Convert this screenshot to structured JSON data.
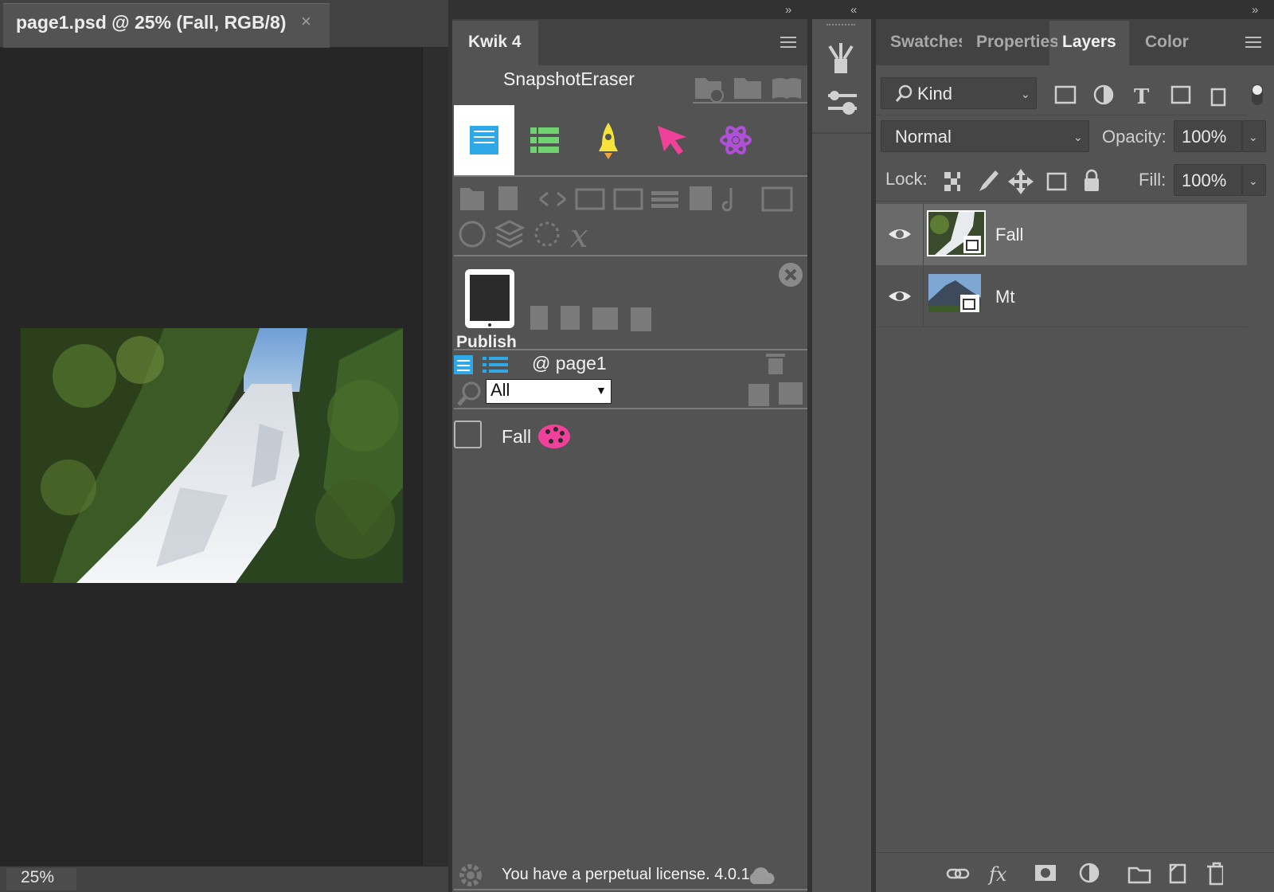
{
  "document": {
    "tab_title": "page1.psd @ 25% (Fall, RGB/8)",
    "close_glyph": "×",
    "zoom": "25%"
  },
  "kwik": {
    "tab_label": "Kwik 4",
    "project_name": "SnapshotEraser",
    "tabs": [
      {
        "name": "pages-tab",
        "color": "#2fa8e8"
      },
      {
        "name": "list-tab",
        "color": "#6fd36f"
      },
      {
        "name": "rocket-tab",
        "color": "#f5e23a"
      },
      {
        "name": "cursor-tab",
        "color": "#f0419a"
      },
      {
        "name": "atom-tab",
        "color": "#b04fd8"
      }
    ],
    "publish_label": "Publish",
    "page_label": "@ page1",
    "filter": {
      "selected": "All"
    },
    "layers": [
      {
        "name": "Fall",
        "checked": false
      }
    ],
    "license": "You have a perpetual license. 4.0.1"
  },
  "layers_panel": {
    "tabs": [
      {
        "label": "Swatches",
        "active": false
      },
      {
        "label": "Properties",
        "active": false
      },
      {
        "label": "Layers",
        "active": true
      },
      {
        "label": "Color",
        "active": false
      }
    ],
    "filter_kind": "Kind",
    "blend_mode": "Normal",
    "opacity_label": "Opacity:",
    "opacity_value": "100%",
    "lock_label": "Lock:",
    "fill_label": "Fill:",
    "fill_value": "100%",
    "layers": [
      {
        "name": "Fall",
        "visible": true,
        "selected": true
      },
      {
        "name": "Mt",
        "visible": true,
        "selected": false
      }
    ]
  },
  "colors": {
    "kwik_blue": "#2fa8e8",
    "kwik_green": "#6fd36f",
    "kwik_yellow": "#f5e23a",
    "kwik_pink": "#f0419a",
    "kwik_purple": "#b04fd8"
  }
}
